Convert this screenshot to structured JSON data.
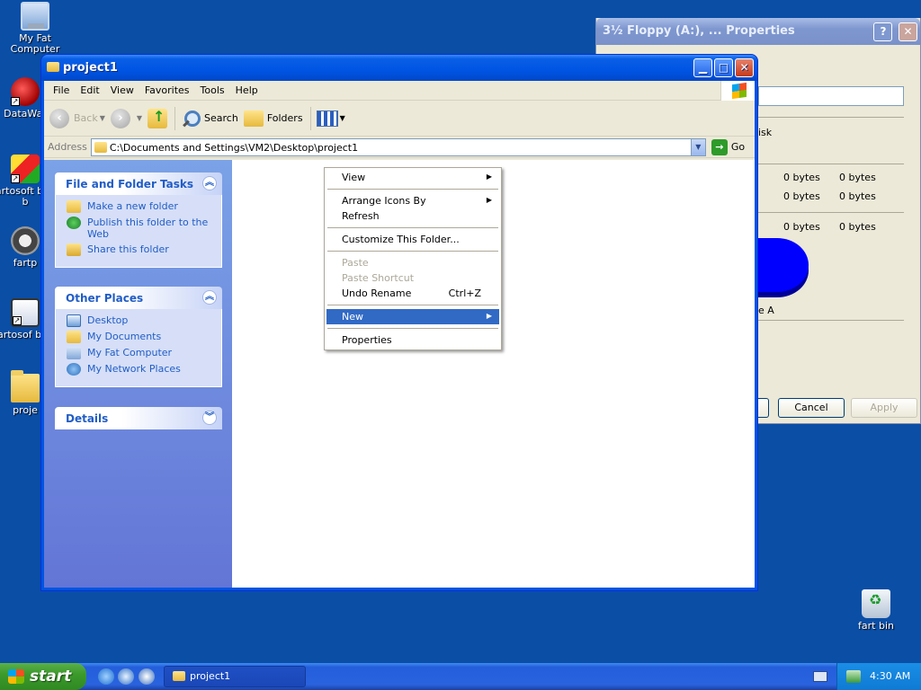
{
  "desktop": {
    "icons": [
      {
        "label": "My Fat Computer"
      },
      {
        "label": "DataWar"
      },
      {
        "label": "fartosoft blah b"
      },
      {
        "label": "fartp"
      },
      {
        "label": "fartosof blah"
      },
      {
        "label": "proje"
      },
      {
        "label": "fart bin"
      }
    ]
  },
  "properties_window": {
    "title": "3½ Floppy (A:), ... Properties",
    "help_label": "?",
    "close_label": "✕",
    "type_text": "isk",
    "rows": [
      {
        "a": "0 bytes",
        "b": "0 bytes"
      },
      {
        "a": "0 bytes",
        "b": "0 bytes"
      },
      {
        "a": "0 bytes",
        "b": "0 bytes"
      }
    ],
    "drive_label": "e A",
    "cancel_label": "Cancel",
    "apply_label": "Apply"
  },
  "explorer": {
    "title": "project1",
    "menu": [
      "File",
      "Edit",
      "View",
      "Favorites",
      "Tools",
      "Help"
    ],
    "toolbar": {
      "back": "Back",
      "search": "Search",
      "folders": "Folders"
    },
    "address": {
      "label": "Address",
      "value": "C:\\Documents and Settings\\VM2\\Desktop\\project1",
      "go": "Go"
    },
    "tasks_panel": {
      "title": "File and Folder Tasks",
      "items": [
        "Make a new folder",
        "Publish this folder to the Web",
        "Share this folder"
      ]
    },
    "places_panel": {
      "title": "Other Places",
      "items": [
        "Desktop",
        "My Documents",
        "My Fat Computer",
        "My Network Places"
      ]
    },
    "details_panel": {
      "title": "Details"
    }
  },
  "context_menu": {
    "view": "View",
    "arrange": "Arrange Icons By",
    "refresh": "Refresh",
    "customize": "Customize This Folder...",
    "paste": "Paste",
    "paste_shortcut": "Paste Shortcut",
    "undo": "Undo Rename",
    "undo_shortcut": "Ctrl+Z",
    "new": "New",
    "properties": "Properties"
  },
  "taskbar": {
    "start": "start",
    "task": "project1",
    "clock": "4:30 AM"
  }
}
